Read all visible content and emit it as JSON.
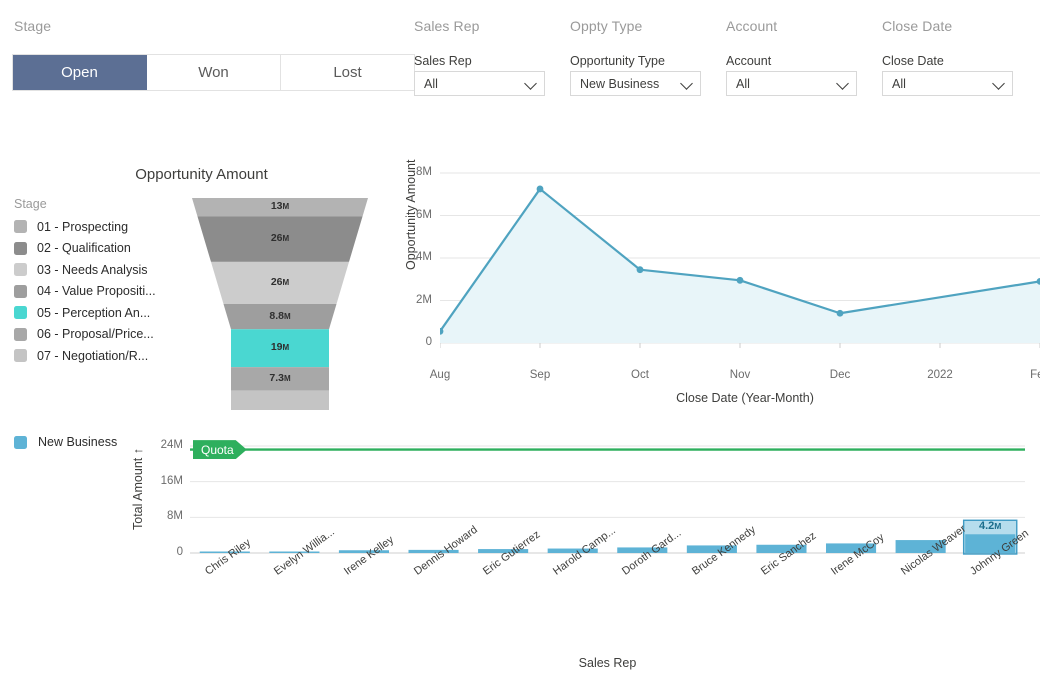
{
  "filters": {
    "stage": {
      "title": "Stage",
      "options": [
        "Open",
        "Won",
        "Lost"
      ],
      "selected": "Open",
      "active_color": "#5c6f94"
    },
    "fields": [
      {
        "title": "Sales Rep",
        "label": "Sales Rep",
        "value": "All"
      },
      {
        "title": "Oppty Type",
        "label": "Opportunity Type",
        "value": "New Business"
      },
      {
        "title": "Account",
        "label": "Account",
        "value": "All"
      },
      {
        "title": "Close Date",
        "label": "Close Date",
        "value": "All"
      }
    ]
  },
  "funnel": {
    "title": "Opportunity Amount",
    "legend_title": "Stage",
    "highlight_color": "#4ad7d1",
    "stages": [
      {
        "label": "01 - Prospecting",
        "color": "#b3b3b3",
        "value": "13",
        "unit": "M"
      },
      {
        "label": "02 - Qualification",
        "color": "#8c8c8c",
        "value": "26",
        "unit": "M"
      },
      {
        "label": "03 - Needs Analysis",
        "color": "#cccccc",
        "value": "26",
        "unit": "M"
      },
      {
        "label": "04 - Value Propositi...",
        "color": "#9e9e9e",
        "value": "8.8",
        "unit": "M"
      },
      {
        "label": "05 - Perception An...",
        "color": "#4ad7d1",
        "value": "19",
        "unit": "M"
      },
      {
        "label": "06 - Proposal/Price...",
        "color": "#a8a8a8",
        "value": "7.3",
        "unit": "M"
      },
      {
        "label": "07 - Negotiation/R...",
        "color": "#c4c4c4",
        "value": "",
        "unit": ""
      }
    ]
  },
  "chart_data": [
    {
      "type": "area",
      "name": "opportunity-amount-over-time",
      "title": "",
      "xlabel": "Close Date (Year-Month)",
      "ylabel": "Opportunity Amount",
      "x": [
        "Aug",
        "Sep",
        "Oct",
        "Nov",
        "Dec",
        "2022",
        "Feb"
      ],
      "ticklabels": [
        "Aug",
        "Sep",
        "Oct",
        "Nov",
        "Dec",
        "2022",
        "Feb"
      ],
      "ytick_labels": [
        "0",
        "2M",
        "4M",
        "6M",
        "8M"
      ],
      "ytick_values": [
        0,
        2000000,
        4000000,
        6000000,
        8000000
      ],
      "ylim": [
        0,
        8000000
      ],
      "values": [
        550000,
        7250000,
        3450000,
        2950000,
        1400000,
        null,
        2900000
      ],
      "line_color": "#4fa3c0",
      "fill_color": "#e8f5f9",
      "grid": true,
      "legend": false
    },
    {
      "type": "bar",
      "name": "total-amount-by-sales-rep",
      "title": "",
      "xlabel": "Sales Rep",
      "ylabel": "Total Amount ↑",
      "categories": [
        "Chris Riley",
        "Evelyn Willia...",
        "Irene Kelley",
        "Dennis Howard",
        "Eric Gutierrez",
        "Harold Camp...",
        "Doroth Gard...",
        "Bruce Kennedy",
        "Eric Sanchez",
        "Irene McCoy",
        "Nicolas Weaver",
        "Johnny Green"
      ],
      "values": [
        90000,
        140000,
        620000,
        700000,
        880000,
        1000000,
        1250000,
        1700000,
        1850000,
        2150000,
        2900000,
        4200000
      ],
      "ytick_labels": [
        "0",
        "8M",
        "16M",
        "24M"
      ],
      "ytick_values": [
        0,
        8000000,
        16000000,
        24000000
      ],
      "ylim": [
        0,
        24000000
      ],
      "bar_color": "#5eb3d6",
      "selected_index": 11,
      "selected_label": "4.2",
      "selected_unit": "M",
      "series_name": "New Business",
      "reference_line": {
        "label": "Quota",
        "value": 23200000,
        "color": "#2eaf5d"
      },
      "grid": true,
      "legend": true
    }
  ]
}
